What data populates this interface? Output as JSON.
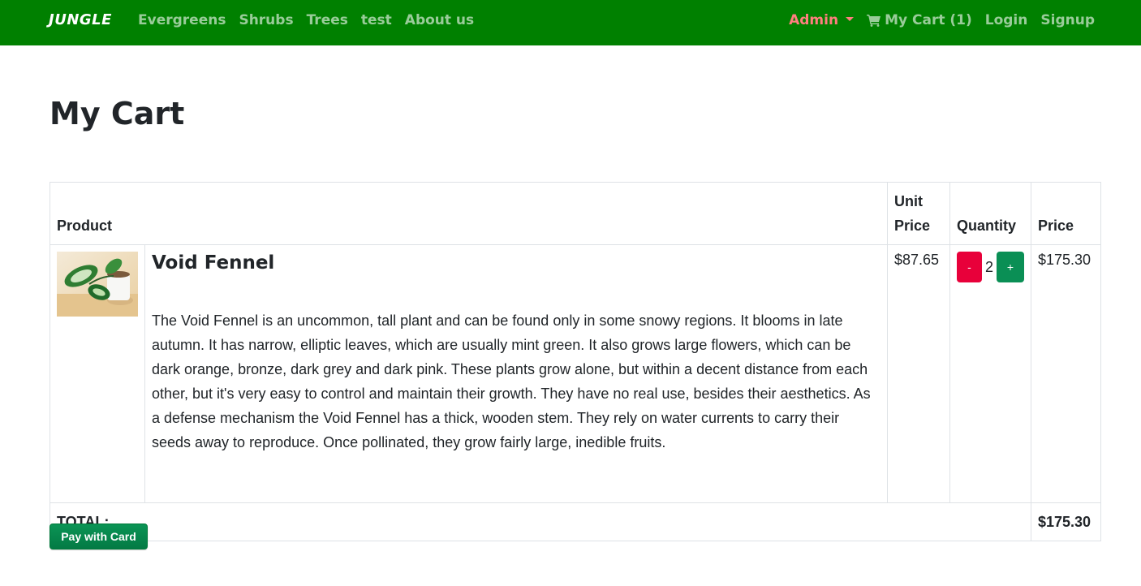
{
  "nav": {
    "brand": "JUNGLE",
    "links": [
      "Evergreens",
      "Shrubs",
      "Trees",
      "test",
      "About us"
    ],
    "admin": "Admin",
    "cart": "My Cart (1)",
    "login": "Login",
    "signup": "Signup"
  },
  "page": {
    "title": "My Cart"
  },
  "table": {
    "headers": {
      "product": "Product",
      "unit_price": "Unit Price",
      "quantity": "Quantity",
      "price": "Price"
    },
    "items": [
      {
        "name": "Void Fennel",
        "description": "The Void Fennel is an uncommon, tall plant and can be found only in some snowy regions. It blooms in late autumn. It has narrow, elliptic leaves, which are usually mint green. It also grows large flowers, which can be dark orange, bronze, dark grey and dark pink. These plants grow alone, but within a decent distance from each other, but it's very easy to control and maintain their growth. They have no real use, besides their aesthetics. As a defense mechanism the Void Fennel has a thick, wooden stem. They rely on water currents to carry their seeds away to reproduce. Once pollinated, they grow fairly large, inedible fruits.",
        "unit_price": "$87.65",
        "quantity": "2",
        "minus": "-",
        "plus": "+",
        "price": "$175.30"
      }
    ],
    "total_label": "TOTAL:",
    "total_value": "$175.30"
  },
  "actions": {
    "pay": "Pay with Card"
  },
  "colors": {
    "navbar": "#008000",
    "admin": "#ff7f7f",
    "minus": "#e8003a",
    "plus": "#0a8f55",
    "pay": "#037a44"
  },
  "icons": {
    "cart": "shopping-cart-icon",
    "admin_dropdown": "caret-down-icon"
  }
}
